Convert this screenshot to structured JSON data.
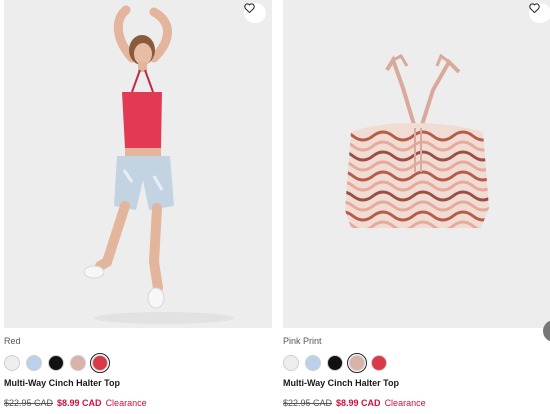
{
  "products": [
    {
      "color_name": "Red",
      "title": "Multi-Way Cinch Halter Top",
      "price_was": "$22.95 CAD",
      "price_now": "$8.99 CAD",
      "badge": "Clearance",
      "swatches": [
        {
          "name": "white",
          "color": "#eeeeec",
          "selected": false
        },
        {
          "name": "light-blue",
          "color": "#bcd0ea",
          "selected": false
        },
        {
          "name": "black",
          "color": "#111111",
          "selected": false
        },
        {
          "name": "pink-print",
          "color": "#d9b3aa",
          "selected": false
        },
        {
          "name": "red",
          "color": "#d83a4a",
          "selected": true
        }
      ]
    },
    {
      "color_name": "Pink Print",
      "title": "Multi-Way Cinch Halter Top",
      "price_was": "$22.95 CAD",
      "price_now": "$8.99 CAD",
      "badge": "Clearance",
      "swatches": [
        {
          "name": "white",
          "color": "#eeeeec",
          "selected": false
        },
        {
          "name": "light-blue",
          "color": "#bcd0ea",
          "selected": false
        },
        {
          "name": "black",
          "color": "#111111",
          "selected": false
        },
        {
          "name": "pink-print",
          "color": "#d9b3aa",
          "selected": true
        },
        {
          "name": "red",
          "color": "#d83a4a",
          "selected": false
        }
      ]
    }
  ],
  "colors": {
    "sale_red": "#d0103a",
    "image_bg": "#ededed"
  }
}
